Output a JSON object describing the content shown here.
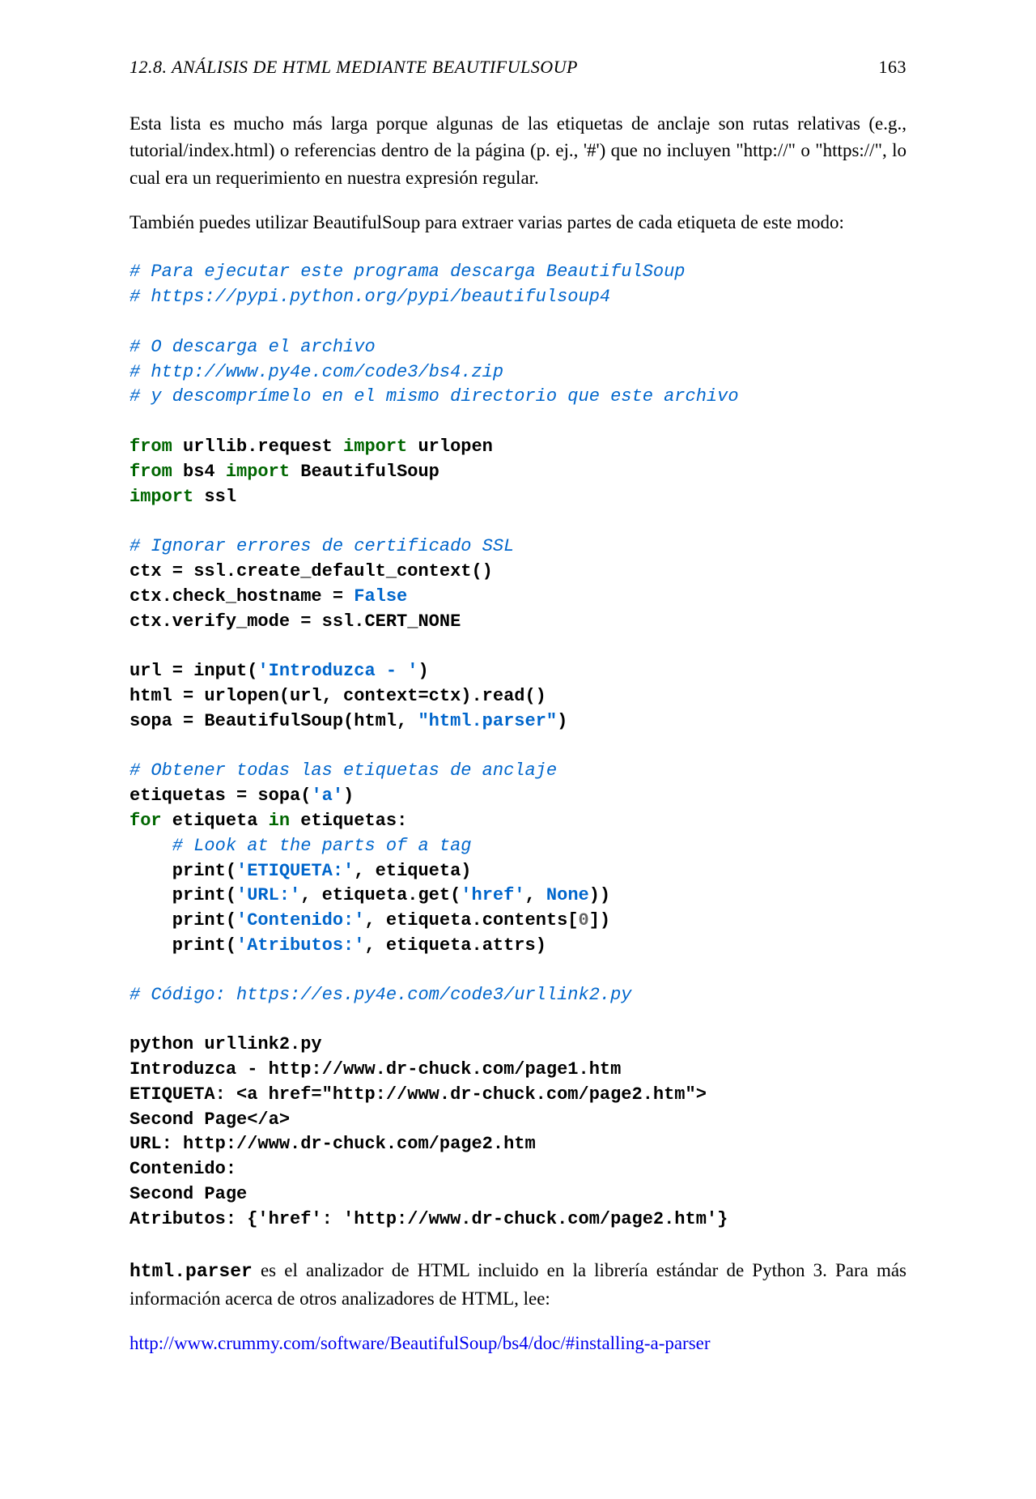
{
  "header": {
    "section": "12.8.  ANÁLISIS DE HTML MEDIANTE BEAUTIFULSOUP",
    "page": "163"
  },
  "para1": "Esta lista es mucho más larga porque algunas de las etiquetas de anclaje son rutas relativas (e.g., tutorial/index.html) o referencias dentro de la página (p. ej., '#') que no incluyen \"http://\" o \"https://\", lo cual era un requerimiento en nuestra expresión regular.",
  "para2": "También puedes utilizar BeautifulSoup para extraer varias partes de cada etiqueta de este modo:",
  "code": {
    "c1": "# Para ejecutar este programa descarga BeautifulSoup",
    "c2": "# https://pypi.python.org/pypi/beautifulsoup4",
    "c3": "# O descarga el archivo",
    "c4": "# http://www.py4e.com/code3/bs4.zip",
    "c5": "# y descomprímelo en el mismo directorio que este archivo",
    "l1a": "from",
    "l1b": " urllib.request ",
    "l1c": "import",
    "l1d": " urlopen",
    "l2a": "from",
    "l2b": " bs4 ",
    "l2c": "import",
    "l2d": " BeautifulSoup",
    "l3a": "import",
    "l3b": " ssl",
    "c6": "# Ignorar errores de certificado SSL",
    "l4": "ctx = ssl.create_default_context()",
    "l5a": "ctx.check_hostname = ",
    "l5b": "False",
    "l6": "ctx.verify_mode = ssl.CERT_NONE",
    "l7a": "url = input(",
    "l7b": "'Introduzca - '",
    "l7c": ")",
    "l8": "html = urlopen(url, context=ctx).read()",
    "l9a": "sopa = BeautifulSoup(html, ",
    "l9b": "\"html.parser\"",
    "l9c": ")",
    "c7": "# Obtener todas las etiquetas de anclaje",
    "l10a": "etiquetas = sopa(",
    "l10b": "'a'",
    "l10c": ")",
    "l11a": "for",
    "l11b": " etiqueta ",
    "l11c": "in",
    "l11d": " etiquetas:",
    "c8": "    # Look at the parts of a tag",
    "l12a": "    print(",
    "l12b": "'ETIQUETA:'",
    "l12c": ", etiqueta)",
    "l13a": "    print(",
    "l13b": "'URL:'",
    "l13c": ", etiqueta.get(",
    "l13d": "'href'",
    "l13e": ", ",
    "l13f": "None",
    "l13g": "))",
    "l14a": "    print(",
    "l14b": "'Contenido:'",
    "l14c": ", etiqueta.contents[",
    "l14d": "0",
    "l14e": "])",
    "l15a": "    print(",
    "l15b": "'Atributos:'",
    "l15c": ", etiqueta.attrs)",
    "c9": "# Código: https://es.py4e.com/code3/urllink2.py"
  },
  "output": {
    "o1": "python urllink2.py",
    "o2": "Introduzca - http://www.dr-chuck.com/page1.htm",
    "o3": "ETIQUETA: <a href=\"http://www.dr-chuck.com/page2.htm\">",
    "o4": "Second Page</a>",
    "o5": "URL: http://www.dr-chuck.com/page2.htm",
    "o6": "Contenido:",
    "o7": "Second Page",
    "o8": "Atributos: {'href': 'http://www.dr-chuck.com/page2.htm'}"
  },
  "para3a": "html.parser",
  "para3b": " es el analizador de HTML incluido en la librería estándar de Python 3. Para más información acerca de otros analizadores de HTML, lee:",
  "link": "http://www.crummy.com/software/BeautifulSoup/bs4/doc/#installing-a-parser"
}
